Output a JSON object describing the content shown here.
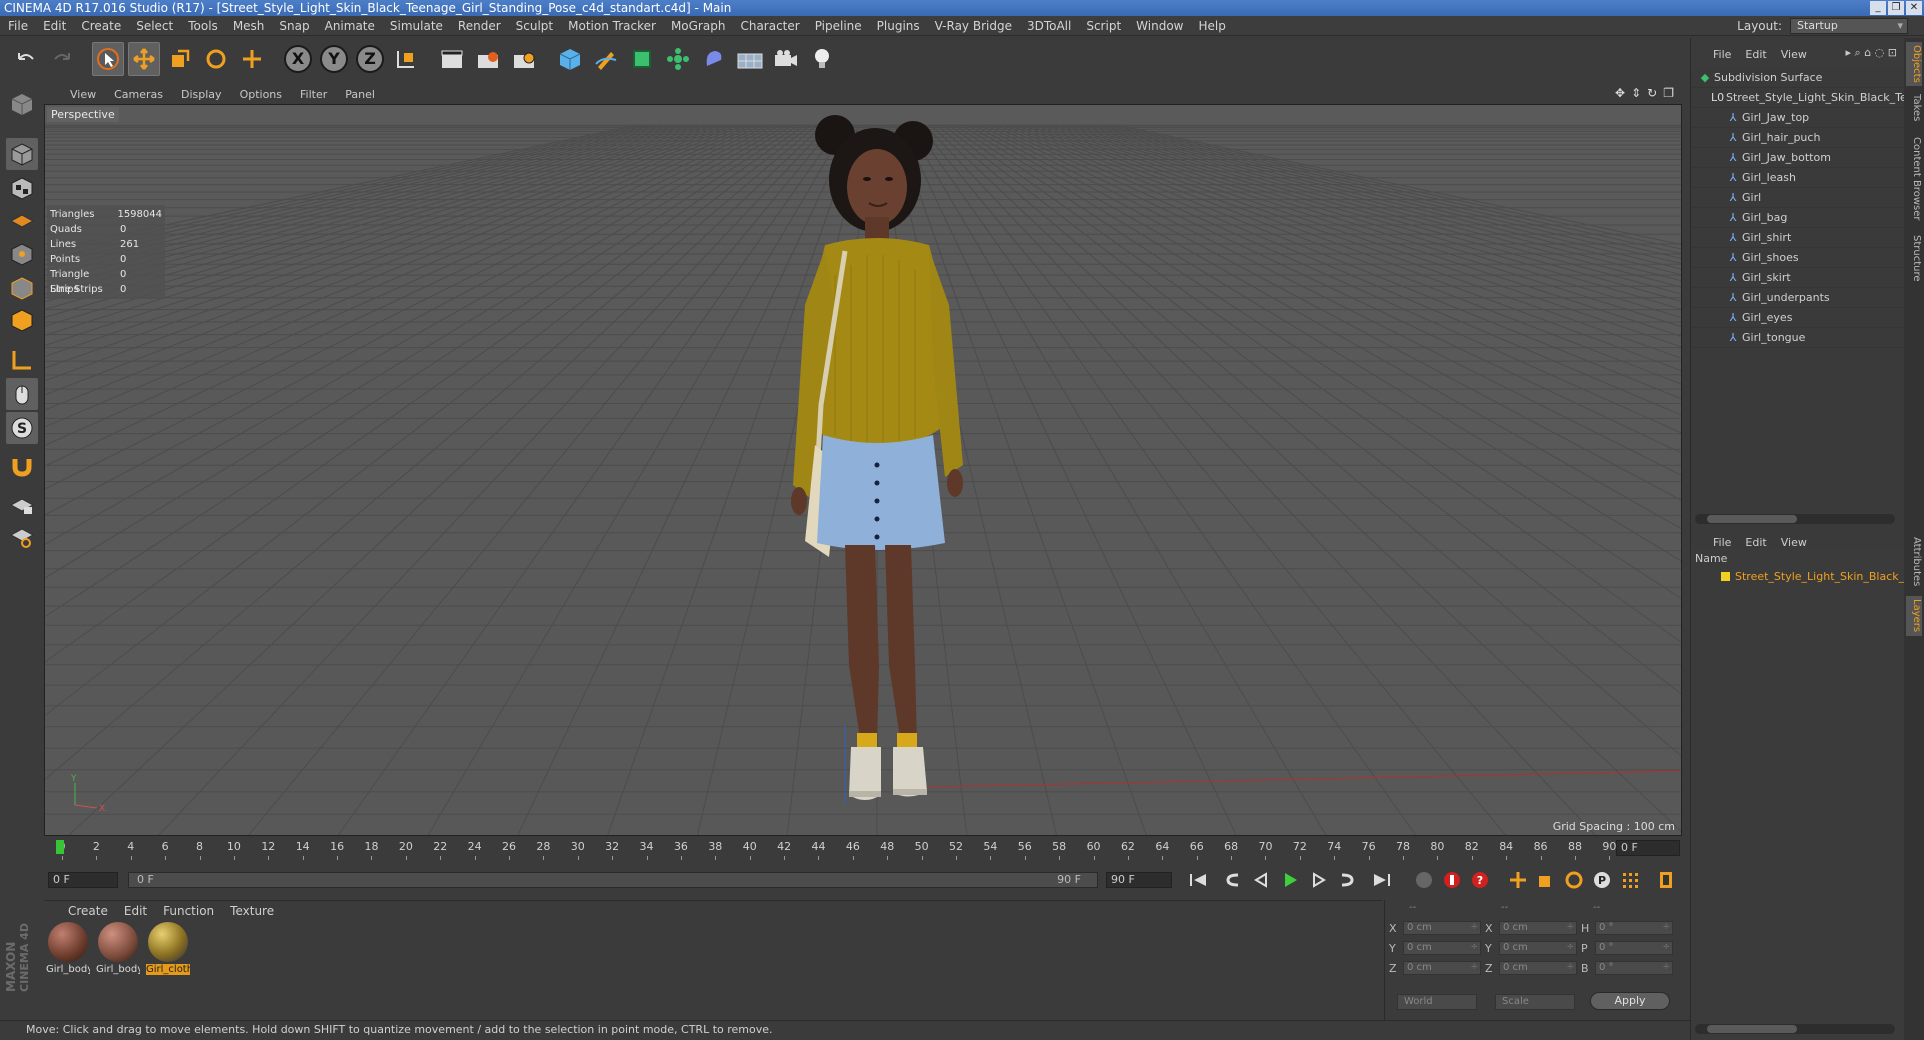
{
  "title": "CINEMA 4D R17.016 Studio (R17) - [Street_Style_Light_Skin_Black_Teenage_Girl_Standing_Pose_c4d_standart.c4d] - Main",
  "window_buttons": [
    "_",
    "❐",
    "✕"
  ],
  "menu": [
    "File",
    "Edit",
    "Create",
    "Select",
    "Tools",
    "Mesh",
    "Snap",
    "Animate",
    "Simulate",
    "Render",
    "Sculpt",
    "Motion Tracker",
    "MoGraph",
    "Character",
    "Pipeline",
    "Plugins",
    "V-Ray Bridge",
    "3DToAll",
    "Script",
    "Window",
    "Help"
  ],
  "layout": {
    "label": "Layout:",
    "value": "Startup"
  },
  "toolbar": {
    "axis": [
      "X",
      "Y",
      "Z"
    ]
  },
  "viewport": {
    "menu": [
      "View",
      "Cameras",
      "Display",
      "Options",
      "Filter",
      "Panel"
    ],
    "label": "Perspective",
    "grid_spacing": "Grid Spacing : 100 cm",
    "stats": [
      {
        "k": "Triangles",
        "v": "1598044"
      },
      {
        "k": "Quads",
        "v": "0"
      },
      {
        "k": "Lines",
        "v": "261"
      },
      {
        "k": "Points",
        "v": "0"
      },
      {
        "k": "Triangle Strips",
        "v": "0"
      },
      {
        "k": "Line Strips",
        "v": "0"
      }
    ]
  },
  "timeline": {
    "ticks": [
      "0",
      "2",
      "4",
      "6",
      "8",
      "10",
      "12",
      "14",
      "16",
      "18",
      "20",
      "22",
      "24",
      "26",
      "28",
      "30",
      "32",
      "34",
      "36",
      "38",
      "40",
      "42",
      "44",
      "46",
      "48",
      "50",
      "52",
      "54",
      "56",
      "58",
      "60",
      "62",
      "64",
      "66",
      "68",
      "70",
      "72",
      "74",
      "76",
      "78",
      "80",
      "82",
      "84",
      "86",
      "88",
      "90"
    ],
    "current_frame": "0 F"
  },
  "transport": {
    "start": "0 F",
    "slider_left": "0 F",
    "slider_right": "90 F",
    "end": "90 F"
  },
  "materials": {
    "menu": [
      "Create",
      "Edit",
      "Function",
      "Texture"
    ],
    "items": [
      {
        "name": "Girl_body",
        "color": "#8a4f3a"
      },
      {
        "name": "Girl_body",
        "color": "#9a5f4a"
      },
      {
        "name": "Girl_cloth",
        "color": "#b89a3a"
      }
    ]
  },
  "coords": {
    "headers": [
      "--",
      "--",
      "--"
    ],
    "rows": [
      {
        "a": "X",
        "av": "0 cm",
        "b": "X",
        "bv": "0 cm",
        "c": "H",
        "cv": "0 °"
      },
      {
        "a": "Y",
        "av": "0 cm",
        "b": "Y",
        "bv": "0 cm",
        "c": "P",
        "cv": "0 °"
      },
      {
        "a": "Z",
        "av": "0 cm",
        "b": "Z",
        "bv": "0 cm",
        "c": "B",
        "cv": "0 °"
      }
    ],
    "mode_world": "World",
    "mode_scale": "Scale",
    "apply": "Apply"
  },
  "status": "Move: Click and drag to move elements. Hold down SHIFT to quantize movement / add to the selection in point mode, CTRL to remove.",
  "objects": {
    "menu": [
      "File",
      "Edit",
      "View"
    ],
    "root": "Subdivision Surface",
    "child": "Street_Style_Light_Skin_Black_Teen",
    "items": [
      "Girl_Jaw_top",
      "Girl_hair_puch",
      "Girl_Jaw_bottom",
      "Girl_leash",
      "Girl",
      "Girl_bag",
      "Girl_shirt",
      "Girl_shoes",
      "Girl_skirt",
      "Girl_underpants",
      "Girl_eyes",
      "Girl_tongue"
    ]
  },
  "layers": {
    "menu": [
      "File",
      "Edit",
      "View"
    ],
    "header": "Name",
    "item": "Street_Style_Light_Skin_Black_Teen"
  },
  "side_tabs": [
    "Objects",
    "Takes",
    "Content Browser",
    "Structure",
    "Attributes",
    "Layers"
  ],
  "brand": [
    "MAXON",
    "CINEMA 4D"
  ]
}
